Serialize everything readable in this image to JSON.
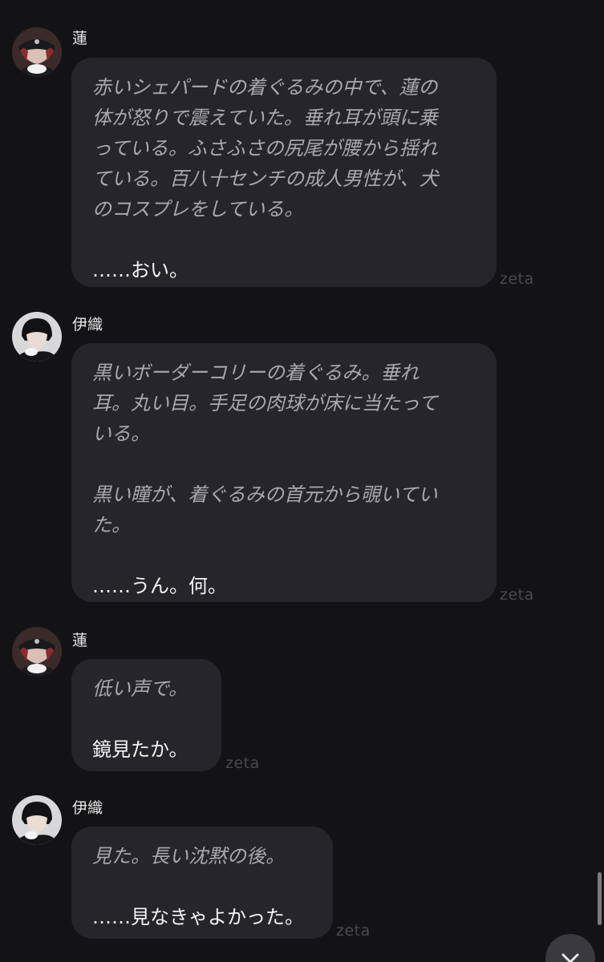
{
  "messages": [
    {
      "sender": "蓮",
      "avatar_icon": "character-avatar-ren",
      "watermark": "zeta",
      "lines": [
        {
          "text": "赤いシェパードの着ぐるみの中で、蓮の",
          "style": "narration"
        },
        {
          "text": "体が怒りで震えていた。垂れ耳が頭に乗",
          "style": "narration"
        },
        {
          "text": "っている。ふさふさの尻尾が腰から揺れ",
          "style": "narration"
        },
        {
          "text": "ている。百八十センチの成人男性が、犬",
          "style": "narration"
        },
        {
          "text": "のコスプレをしている。",
          "style": "narration"
        },
        {
          "text": "",
          "style": "blank"
        },
        {
          "text": "……おい。",
          "style": "dialogue"
        }
      ]
    },
    {
      "sender": "伊織",
      "avatar_icon": "character-avatar-iori",
      "watermark": "zeta",
      "lines": [
        {
          "text": "黒いボーダーコリーの着ぐるみ。垂れ",
          "style": "narration"
        },
        {
          "text": "耳。丸い目。手足の肉球が床に当たって",
          "style": "narration"
        },
        {
          "text": "いる。",
          "style": "narration"
        },
        {
          "text": "",
          "style": "blank"
        },
        {
          "text": "黒い瞳が、着ぐるみの首元から覗いてい",
          "style": "narration"
        },
        {
          "text": "た。",
          "style": "narration"
        },
        {
          "text": "",
          "style": "blank"
        },
        {
          "text": "……うん。何。",
          "style": "dialogue"
        }
      ]
    },
    {
      "sender": "蓮",
      "avatar_icon": "character-avatar-ren",
      "watermark": "zeta",
      "lines": [
        {
          "text": "低い声で。",
          "style": "narration"
        },
        {
          "text": "",
          "style": "blank"
        },
        {
          "text": "鏡見たか。",
          "style": "dialogue"
        }
      ]
    },
    {
      "sender": "伊織",
      "avatar_icon": "character-avatar-iori",
      "watermark": "zeta",
      "lines": [
        {
          "text": "見た。長い沈黙の後。",
          "style": "narration"
        },
        {
          "text": "",
          "style": "blank"
        },
        {
          "text": "……見なきゃよかった。",
          "style": "dialogue"
        }
      ]
    }
  ],
  "controls": {
    "scroll_down_icon": "chevron-down-icon"
  }
}
